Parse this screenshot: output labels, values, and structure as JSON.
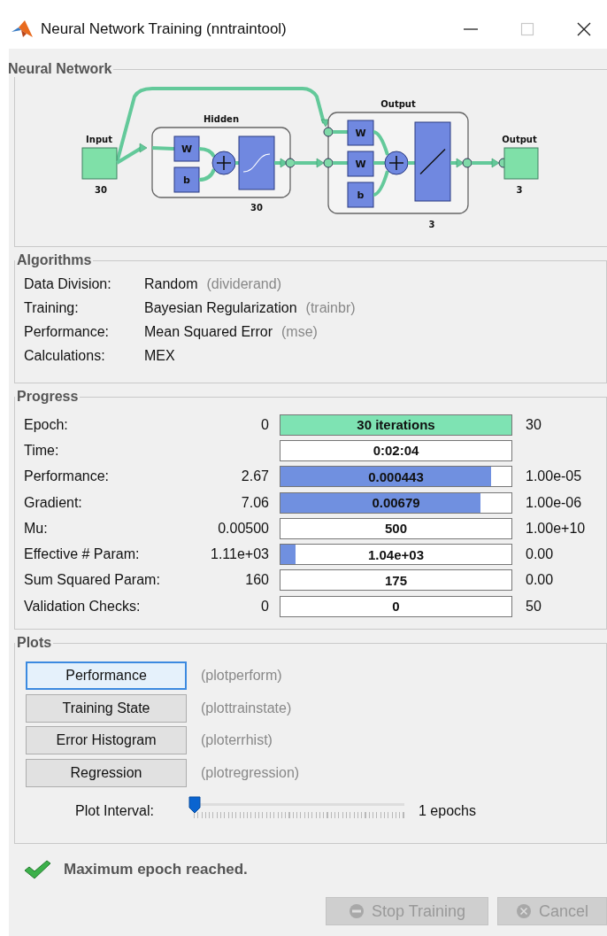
{
  "window": {
    "title": "Neural Network Training (nntraintool)",
    "controls": [
      {
        "kind": "minimize",
        "disabled": false
      },
      {
        "kind": "maximize",
        "disabled": true
      },
      {
        "kind": "close",
        "disabled": false
      }
    ]
  },
  "network": {
    "title": "Neural Network",
    "input": {
      "label": "Input",
      "size": "30"
    },
    "layers": [
      {
        "title": "Hidden",
        "size": "30",
        "weights": [
          "W"
        ],
        "bias": "b",
        "kind": "sigmoid"
      },
      {
        "title": "Output",
        "size": "3",
        "weights": [
          "W",
          "W"
        ],
        "bias": "b",
        "kind": "linear"
      }
    ],
    "output": {
      "label": "Output",
      "size": "3"
    }
  },
  "algorithms": {
    "title": "Algorithms",
    "rows": [
      {
        "label": "Data Division:",
        "value": "Random",
        "function": "(dividerand)"
      },
      {
        "label": "Training:",
        "value": "Bayesian Regularization",
        "function": "(trainbr)"
      },
      {
        "label": "Performance:",
        "value": "Mean Squared Error",
        "function": "(mse)"
      },
      {
        "label": "Calculations:",
        "value": "MEX"
      }
    ]
  },
  "progress": {
    "title": "Progress",
    "rows": [
      {
        "label": "Epoch:",
        "start": "0",
        "value": "30 iterations",
        "target": "30",
        "level": 1,
        "color": "#7ee3b3"
      },
      {
        "label": "Time:",
        "value": "0:02:04"
      },
      {
        "label": "Performance:",
        "start": "2.67",
        "value": "0.000443",
        "target": "1.00e-05",
        "level": 0.91,
        "color": "#7090e0"
      },
      {
        "label": "Gradient:",
        "start": "7.06",
        "value": "0.00679",
        "target": "1.00e-06",
        "level": 0.866,
        "color": "#7090e0"
      },
      {
        "label": "Mu:",
        "start": "0.00500",
        "value": "500",
        "target": "1.00e+10"
      },
      {
        "label": "Effective # Param:",
        "start": "1.11e+03",
        "value": "1.04e+03",
        "target": "0.00",
        "level": 0.065,
        "color": "#7090e0"
      },
      {
        "label": "Sum Squared Param:",
        "start": "160",
        "value": "175",
        "target": "0.00"
      },
      {
        "label": "Validation Checks:",
        "start": "0",
        "value": "0",
        "target": "50"
      }
    ]
  },
  "plots": {
    "title": "Plots",
    "buttons": [
      {
        "label": "Performance",
        "function": "(plotperform)",
        "selected": true
      },
      {
        "label": "Training State",
        "function": "(plottrainstate)",
        "selected": false
      },
      {
        "label": "Error Histogram",
        "function": "(ploterrhist)",
        "selected": false
      },
      {
        "label": "Regression",
        "function": "(plotregression)",
        "selected": false
      }
    ],
    "interval": {
      "label": "Plot Interval:",
      "level": 0,
      "reading": "1 epochs"
    }
  },
  "status": {
    "message": "Maximum epoch reached."
  },
  "buttons": [
    {
      "label": "Stop Training",
      "kind": "stop",
      "disabled": true
    },
    {
      "label": "Cancel",
      "kind": "cancel",
      "disabled": true
    }
  ]
}
